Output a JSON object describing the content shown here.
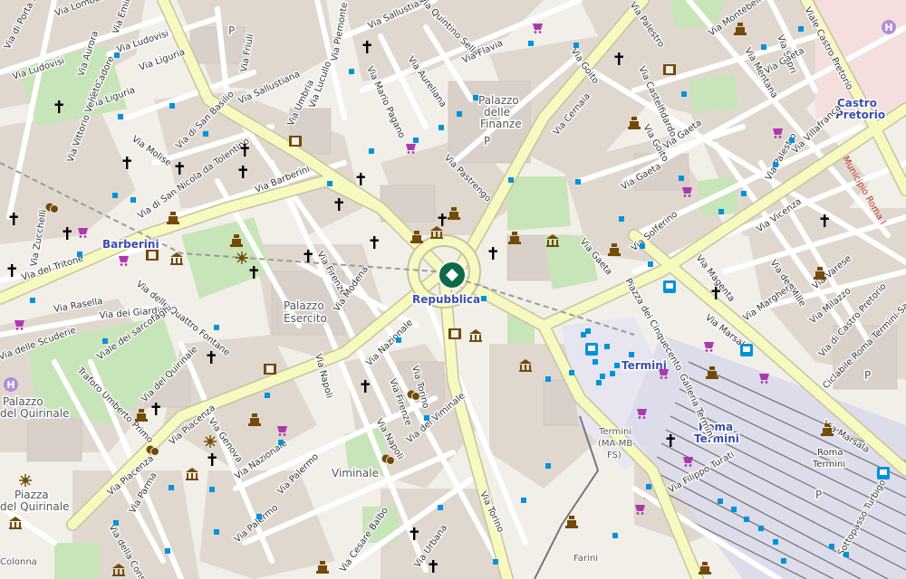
{
  "colors": {
    "land": "#f2efe9",
    "block": "#e0d8cf",
    "building": "#d9d0c9",
    "park": "#c8e5b9",
    "primary_road": "#f7fabf",
    "road_casing": "#c9c2a0",
    "minor_road": "#ffffff",
    "station_area": "#e7e6f0",
    "railway": "#707070",
    "poi_brown": "#734a08",
    "poi_blue": "#0092da",
    "poi_purple": "#ac39ac",
    "marker": "#0e6b45"
  },
  "places": [
    {
      "id": "barberini",
      "text": "Barberini",
      "kind": "station"
    },
    {
      "id": "repubblica",
      "text": "Repubblica",
      "kind": "station"
    },
    {
      "id": "termini",
      "text": "Termini",
      "kind": "station"
    },
    {
      "id": "castro-pretorio-1",
      "text": "Castro",
      "kind": "station"
    },
    {
      "id": "castro-pretorio-2",
      "text": "Pretorio",
      "kind": "station"
    },
    {
      "id": "roma-termini-1",
      "text": "Roma",
      "kind": "station"
    },
    {
      "id": "roma-termini-2",
      "text": "Termini",
      "kind": "station"
    },
    {
      "id": "palazzo-finanze-1",
      "text": "Palazzo",
      "kind": "place"
    },
    {
      "id": "palazzo-finanze-2",
      "text": "delle",
      "kind": "place"
    },
    {
      "id": "palazzo-finanze-3",
      "text": "Finanze",
      "kind": "place"
    },
    {
      "id": "palazzo-esercito-1",
      "text": "Palazzo",
      "kind": "place"
    },
    {
      "id": "palazzo-esercito-2",
      "text": "Esercito",
      "kind": "place"
    },
    {
      "id": "palazzo-quirinale-1",
      "text": "Palazzo",
      "kind": "place"
    },
    {
      "id": "palazzo-quirinale-2",
      "text": "del Quirinale",
      "kind": "place"
    },
    {
      "id": "piazza-quirinale-1",
      "text": "Piazza",
      "kind": "place"
    },
    {
      "id": "piazza-quirinale-2",
      "text": "del Quirinale",
      "kind": "place"
    },
    {
      "id": "viminale",
      "text": "Viminale",
      "kind": "place"
    },
    {
      "id": "termini-mamb-1",
      "text": "Termini",
      "kind": "rail"
    },
    {
      "id": "termini-mamb-2",
      "text": "(MA-MB-",
      "kind": "rail"
    },
    {
      "id": "termini-mamb-3",
      "text": "FS)",
      "kind": "rail"
    },
    {
      "id": "roma-termini-rail-1",
      "text": "Roma",
      "kind": "rail"
    },
    {
      "id": "roma-termini-rail-2",
      "text": "Termini",
      "kind": "rail"
    },
    {
      "id": "farini",
      "text": "Farini",
      "kind": "rail"
    },
    {
      "id": "colonna",
      "text": "Colonna",
      "kind": "rail"
    },
    {
      "id": "p-finanze",
      "text": "P",
      "kind": "parking"
    },
    {
      "id": "p-termini",
      "text": "P",
      "kind": "parking"
    },
    {
      "id": "p-east",
      "text": "P",
      "kind": "parking"
    },
    {
      "id": "p-north",
      "text": "P",
      "kind": "parking"
    }
  ],
  "streets": [
    {
      "id": "via-porta-pinciana",
      "text": "Via di Porta Pinciana"
    },
    {
      "id": "via-lombardia",
      "text": "Via Lombardia"
    },
    {
      "id": "via-emilia",
      "text": "Via Emilia"
    },
    {
      "id": "via-aurora",
      "text": "Via Aurora"
    },
    {
      "id": "via-ludovisi-1",
      "text": "Via Ludovisi"
    },
    {
      "id": "via-ludovisi-2",
      "text": "Via Ludovisi"
    },
    {
      "id": "via-liguria-1",
      "text": "Via Liguria"
    },
    {
      "id": "via-liguria-2",
      "text": "Via Liguria"
    },
    {
      "id": "via-cadore",
      "text": "Via Cadore"
    },
    {
      "id": "via-friuli",
      "text": "Via Friuli"
    },
    {
      "id": "via-piemonte",
      "text": "Via Piemonte"
    },
    {
      "id": "via-sallustiana-1",
      "text": "Via Sallustiana"
    },
    {
      "id": "via-sallustiana-2",
      "text": "Via Sallustiana"
    },
    {
      "id": "via-quintino-sella",
      "text": "Via Quintino Sella"
    },
    {
      "id": "via-flavia",
      "text": "Via Flavia"
    },
    {
      "id": "via-aureliana",
      "text": "Via Aureliana"
    },
    {
      "id": "via-mario-pagano",
      "text": "Via Mario Pagano"
    },
    {
      "id": "via-palestro-1",
      "text": "Via Palestro"
    },
    {
      "id": "via-palestro-2",
      "text": "Via Palestro"
    },
    {
      "id": "via-montebello",
      "text": "Via Montebello"
    },
    {
      "id": "via-mentana",
      "text": "Via Mentana"
    },
    {
      "id": "via-sapri",
      "text": "Via Sapri"
    },
    {
      "id": "viale-castro-pretorio",
      "text": "Viale Castro Pretorio"
    },
    {
      "id": "via-goito-1",
      "text": "Via Goito"
    },
    {
      "id": "via-goito-2",
      "text": "Via Goito"
    },
    {
      "id": "via-gaeta-1",
      "text": "Via Gaeta"
    },
    {
      "id": "via-gaeta-2",
      "text": "Via Gaeta"
    },
    {
      "id": "via-gaeta-3",
      "text": "Via Gaeta"
    },
    {
      "id": "via-gaeta-4",
      "text": "Via Gaeta"
    },
    {
      "id": "via-castelfidardo",
      "text": "Via Castelfidardo"
    },
    {
      "id": "via-cernaia",
      "text": "Via Cernaia"
    },
    {
      "id": "via-pastrengo",
      "text": "Via Pastrengo"
    },
    {
      "id": "via-vittorio-veneto",
      "text": "Via Vittorio Veneto"
    },
    {
      "id": "via-molise",
      "text": "Via Molise"
    },
    {
      "id": "via-san-basilio",
      "text": "Via di San Basilio"
    },
    {
      "id": "via-umbria",
      "text": "Via Umbria"
    },
    {
      "id": "via-lucullo",
      "text": "Via Lucullo"
    },
    {
      "id": "via-san-nicola",
      "text": "Via di San Nicola da Tolentino"
    },
    {
      "id": "via-barberini",
      "text": "Via Barberini"
    },
    {
      "id": "via-zucchelli",
      "text": "Via Zucchelli"
    },
    {
      "id": "via-tritone",
      "text": "Via del Tritone"
    },
    {
      "id": "via-quattro-fontane",
      "text": "Via delle Quattro Fontane"
    },
    {
      "id": "via-rasella",
      "text": "Via Rasella"
    },
    {
      "id": "via-giardini",
      "text": "Via dei Giardini"
    },
    {
      "id": "via-scuderie",
      "text": "Via delle Scuderie"
    },
    {
      "id": "viale-sarcofaghi",
      "text": "Viale dei sarcofaghi"
    },
    {
      "id": "traforo-umberto",
      "text": "Traforo Umberto Primo"
    },
    {
      "id": "via-quirinale",
      "text": "Via del Quirinale"
    },
    {
      "id": "via-piacenza-1",
      "text": "Via Piacenza"
    },
    {
      "id": "via-piacenza-2",
      "text": "Via Piacenza"
    },
    {
      "id": "via-genova",
      "text": "Via Genova"
    },
    {
      "id": "via-nazionale-1",
      "text": "Via Nazionale"
    },
    {
      "id": "via-nazionale-2",
      "text": "Via Nazionale"
    },
    {
      "id": "via-napoli-1",
      "text": "Via Napoli"
    },
    {
      "id": "via-napoli-2",
      "text": "Via Napoli"
    },
    {
      "id": "via-firenze-1",
      "text": "Via Firenze"
    },
    {
      "id": "via-firenze-2",
      "text": "Via Firenze"
    },
    {
      "id": "via-modena",
      "text": "Via Modena"
    },
    {
      "id": "via-torino-1",
      "text": "Via Torino"
    },
    {
      "id": "via-torino-2",
      "text": "Via Torino"
    },
    {
      "id": "via-viminale",
      "text": "Via del Viminale"
    },
    {
      "id": "via-palermo-1",
      "text": "Via Palermo"
    },
    {
      "id": "via-palermo-2",
      "text": "Via Palermo"
    },
    {
      "id": "via-parma",
      "text": "Via Parma"
    },
    {
      "id": "via-consulta",
      "text": "Via della Consulta"
    },
    {
      "id": "via-cesare-balbo",
      "text": "Via Cesare Balbo"
    },
    {
      "id": "via-urbana",
      "text": "Via Urbana"
    },
    {
      "id": "via-filippo-turati",
      "text": "Via Filippo Turati"
    },
    {
      "id": "via-solferino",
      "text": "Via Solferino"
    },
    {
      "id": "via-vicenza",
      "text": "Via Vicenza"
    },
    {
      "id": "via-magenta",
      "text": "Via Magenta"
    },
    {
      "id": "via-mille",
      "text": "Via dei Mille"
    },
    {
      "id": "via-varese",
      "text": "Via Varese"
    },
    {
      "id": "via-villafranca",
      "text": "Via Villafranca"
    },
    {
      "id": "via-milazzo",
      "text": "Via Milazzo"
    },
    {
      "id": "via-marghera",
      "text": "Via Marghera"
    },
    {
      "id": "via-marsala-1",
      "text": "Via Marsala"
    },
    {
      "id": "via-marsala-2",
      "text": "Via Marsala"
    },
    {
      "id": "piazza-cinquecento",
      "text": "Piazza dei Cinquecento"
    },
    {
      "id": "galleria-termini",
      "text": "Galleria Termini"
    },
    {
      "id": "via-castro-pretorio",
      "text": "Via di Castro Pretorio"
    },
    {
      "id": "ciclabile",
      "text": "Ciclabile Roma Termini-Sapienza"
    },
    {
      "id": "sottopasso",
      "text": "Sottopasso Turbigo"
    },
    {
      "id": "rome-termini-mini-1",
      "text": "Roma"
    },
    {
      "id": "rome-termini-mini-2",
      "text": "Termini"
    }
  ],
  "municipio": {
    "text": "Municipio Roma I"
  },
  "marker": {
    "icon": "location-pin-icon"
  },
  "pois": [
    {
      "icon": "church-icon",
      "label": "",
      "kind": "church"
    },
    {
      "icon": "museum-icon",
      "label": "",
      "kind": "museum"
    },
    {
      "icon": "theatre-icon",
      "label": "",
      "kind": "theatre"
    },
    {
      "icon": "cinema-icon",
      "label": "",
      "kind": "cinema"
    },
    {
      "icon": "shop-icon",
      "label": "",
      "kind": "shop"
    },
    {
      "icon": "bus-stop-icon",
      "label": "",
      "kind": "bus"
    },
    {
      "icon": "hospital-icon",
      "label": "H",
      "kind": "hospital"
    },
    {
      "icon": "monument-icon",
      "label": "",
      "kind": "monument"
    },
    {
      "icon": "fountain-icon",
      "label": "",
      "kind": "fountain"
    }
  ]
}
